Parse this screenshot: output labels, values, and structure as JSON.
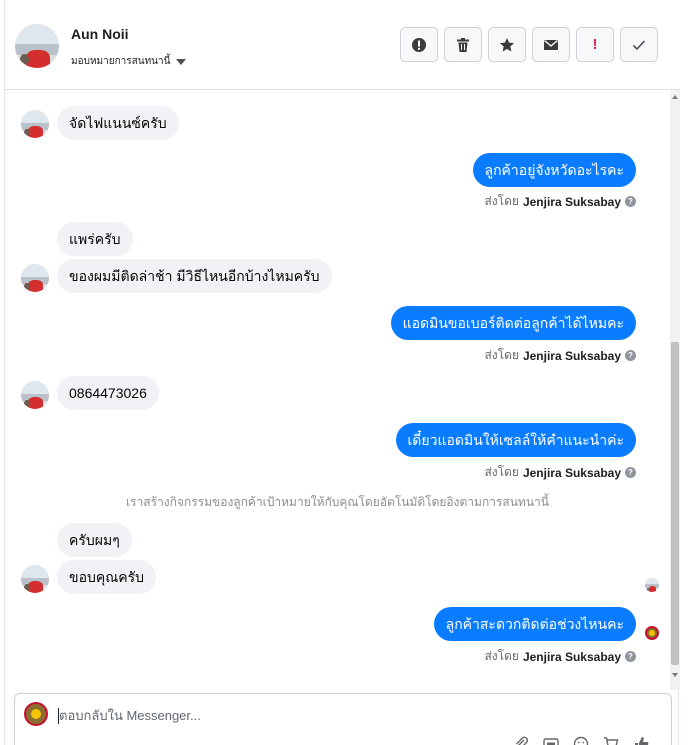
{
  "header": {
    "name": "Aun Noii",
    "assign_label": "มอบหมายการสนทนานี้",
    "toolbar_icons": [
      "alert-icon",
      "trash-icon",
      "star-icon",
      "mail-icon",
      "spam-icon",
      "check-icon"
    ],
    "spam_glyph": "!"
  },
  "messages": {
    "m1": "จัดไฟแนนซ์ครับ",
    "m2": "ลูกค้าอยู่จังหวัดอะไรคะ",
    "m3": "แพร่ครับ",
    "m4": "ของผมมีติดล่าช้า มีวิธีไหนอีกบ้างไหมครับ",
    "m5": "แอดมินขอเบอร์ติดต่อลูกค้าได้ไหมคะ",
    "m6": "0864473026",
    "m7": "เดี๋ยวแอดมินให้เซลล์ให้คำแนะนำค่ะ",
    "m8": "ครับผมๆ",
    "m9": "ขอบคุณครับ",
    "m10": "ลูกค้าสะดวกติดต่อช่วงไหนคะ"
  },
  "sent_by": {
    "prefix": "ส่งโดย",
    "agent": "Jenjira Suksabay",
    "info": "?"
  },
  "system_notice": "เราสร้างกิจกรรมของลูกค้าเป้าหมายให้กับคุณโดยอัตโนมัติโดยอิงตามการสนทนานี้",
  "composer": {
    "placeholder": "ตอบกลับใน Messenger...",
    "icons": [
      "attach-icon",
      "gif-icon",
      "emoji-icon",
      "cart-icon",
      "like-icon"
    ]
  },
  "colors": {
    "outgoing": "#0a7cff",
    "incoming": "#f0f2f5"
  }
}
